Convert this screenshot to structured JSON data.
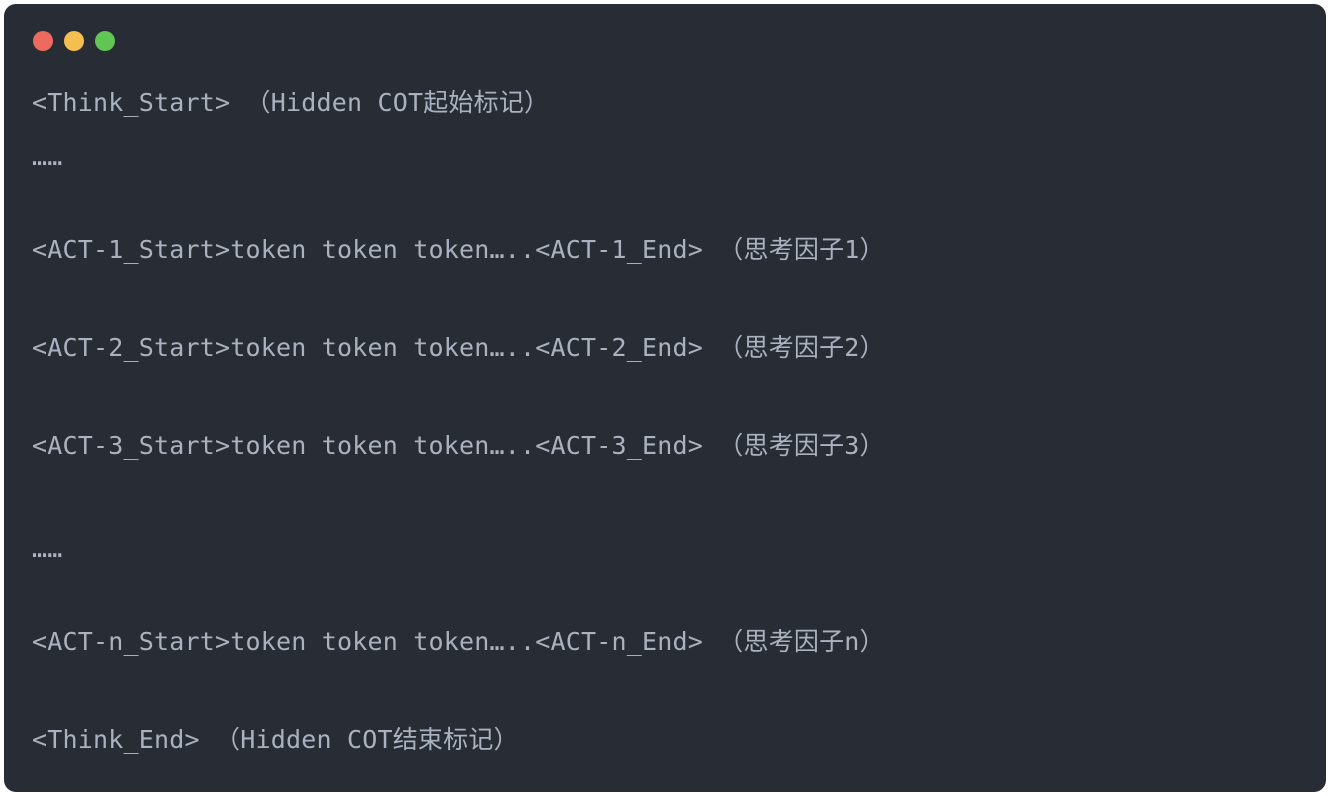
{
  "window": {
    "controls": {
      "close_color": "#ed6a5e",
      "minimize_color": "#f5bf4f",
      "maximize_color": "#61c554"
    }
  },
  "code": {
    "lines": [
      "<Think_Start> （Hidden COT起始标记）",
      "……",
      "<ACT-1_Start>token token token…..<ACT-1_End> （思考因子1）",
      "<ACT-2_Start>token token token…..<ACT-2_End> （思考因子2）",
      "<ACT-3_Start>token token token…..<ACT-3_End> （思考因子3）",
      "……",
      "<ACT-n_Start>token token token…..<ACT-n_End> （思考因子n）",
      "<Think_End> （Hidden COT结束标记）"
    ]
  }
}
